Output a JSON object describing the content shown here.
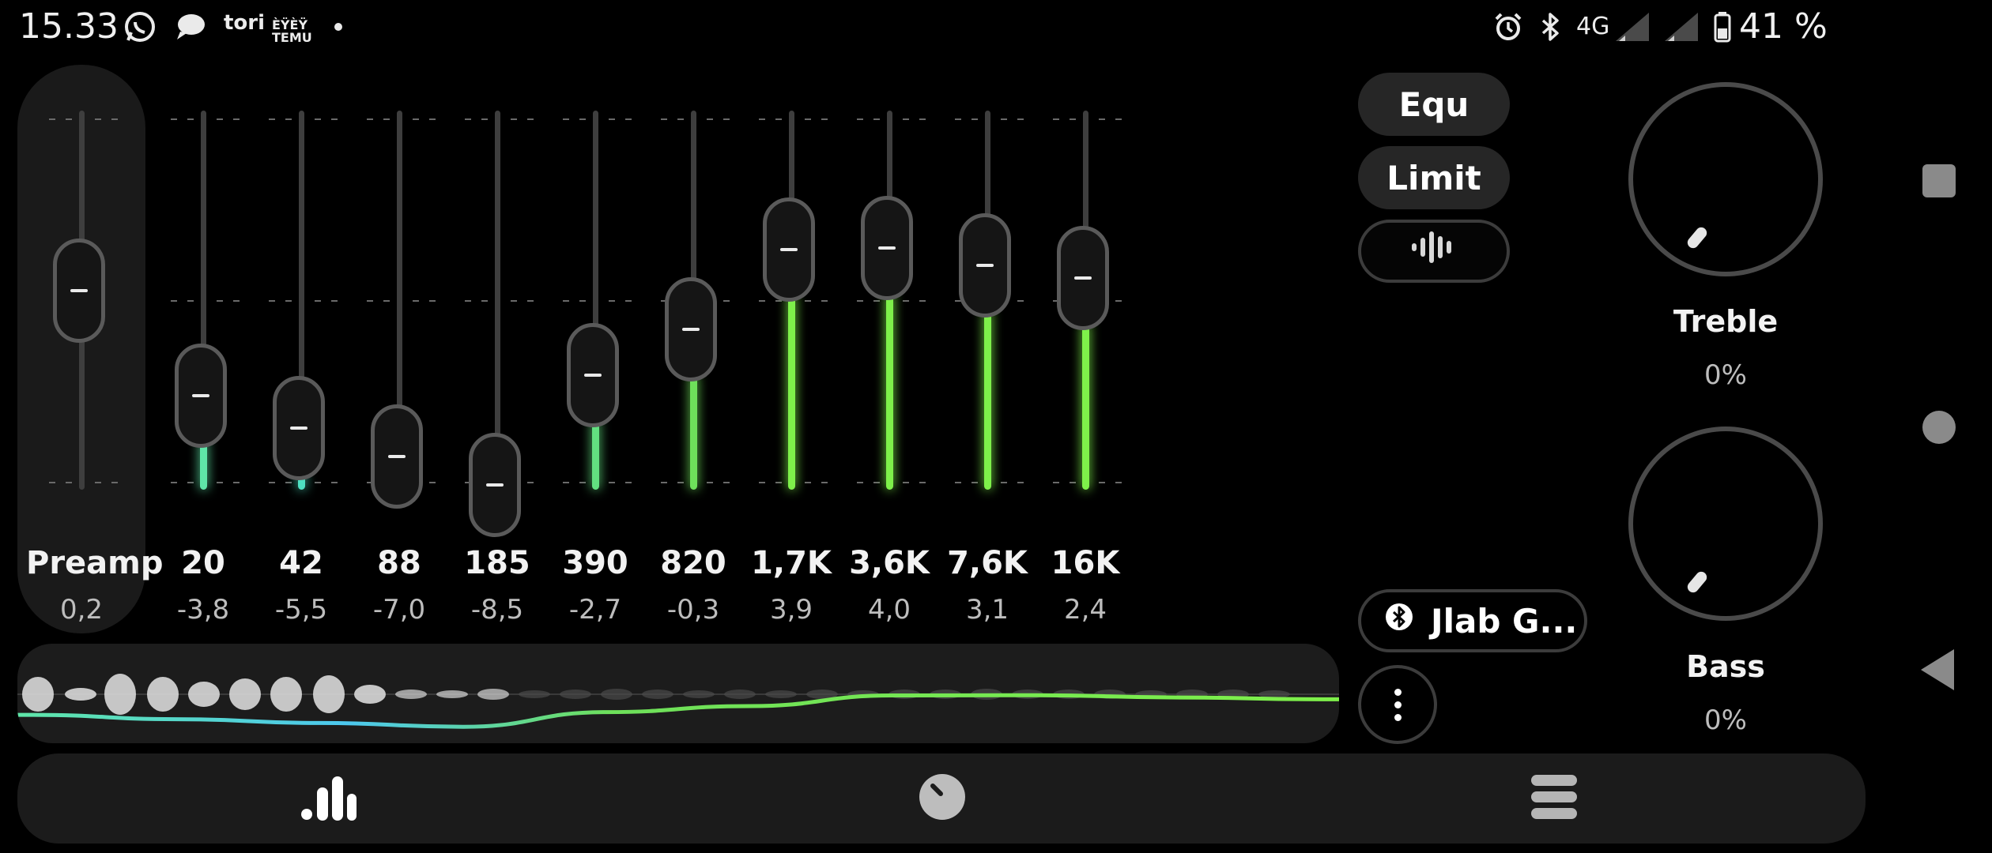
{
  "status_bar": {
    "time": "15.33",
    "notification_icons": [
      "whatsapp-icon",
      "chat-bubble-icon",
      "tori-app-icon",
      "temu-app-icon",
      "dot-indicator"
    ],
    "tori_label": "tori",
    "temu_label": "TEMU",
    "temu_top_label": "ÈŸÈŸ",
    "right_icons": [
      "alarm-icon",
      "bluetooth-icon",
      "signal-icon",
      "signal-icon",
      "battery-icon"
    ],
    "network": "4G",
    "battery_percent": "41 %"
  },
  "equalizer": {
    "preamp": {
      "label": "Preamp",
      "value": "0,2",
      "level": 0.2
    },
    "bands": [
      {
        "freq": "20",
        "value": "-3,8",
        "gain": -3.8,
        "color": "#5fe6a8"
      },
      {
        "freq": "42",
        "value": "-5,5",
        "gain": -5.5,
        "color": "#4ee0c2"
      },
      {
        "freq": "88",
        "value": "-7,0",
        "gain": -7.0,
        "color": "#54d8e6"
      },
      {
        "freq": "185",
        "value": "-8,5",
        "gain": -8.5,
        "color": "#4cc8ef"
      },
      {
        "freq": "390",
        "value": "-2,7",
        "gain": -2.7,
        "color": "#62e080"
      },
      {
        "freq": "820",
        "value": "-0,3",
        "gain": -0.3,
        "color": "#6ee05a"
      },
      {
        "freq": "1,7K",
        "value": "3,9",
        "gain": 3.9,
        "color": "#7ef04a"
      },
      {
        "freq": "3,6K",
        "value": "4,0",
        "gain": 4.0,
        "color": "#7ef04a"
      },
      {
        "freq": "7,6K",
        "value": "3,1",
        "gain": 3.1,
        "color": "#7ef04a"
      },
      {
        "freq": "16K",
        "value": "2,4",
        "gain": 2.4,
        "color": "#7ef04a"
      }
    ]
  },
  "controls": {
    "equ_label": "Equ",
    "limit_label": "Limit",
    "visualizer_icon": "waveform-icon",
    "device_icon": "bluetooth-icon",
    "device_name": "Jlab G...",
    "more_icon": "more-vertical-icon"
  },
  "knobs": {
    "treble": {
      "label": "Treble",
      "value": "0%",
      "level": 0
    },
    "bass": {
      "label": "Bass",
      "value": "0%",
      "level": 0
    }
  },
  "system_nav": [
    "recents-square-icon",
    "home-circle-icon",
    "back-triangle-icon"
  ],
  "bottom_tabs": [
    {
      "icon": "equalizer-bars-icon",
      "active": true
    },
    {
      "icon": "knob-icon",
      "active": false
    },
    {
      "icon": "presets-stack-icon",
      "active": false
    }
  ],
  "colors": {
    "accent_green": "#7ef04a",
    "accent_cyan": "#54d8e6",
    "panel": "#1a1a1a"
  }
}
